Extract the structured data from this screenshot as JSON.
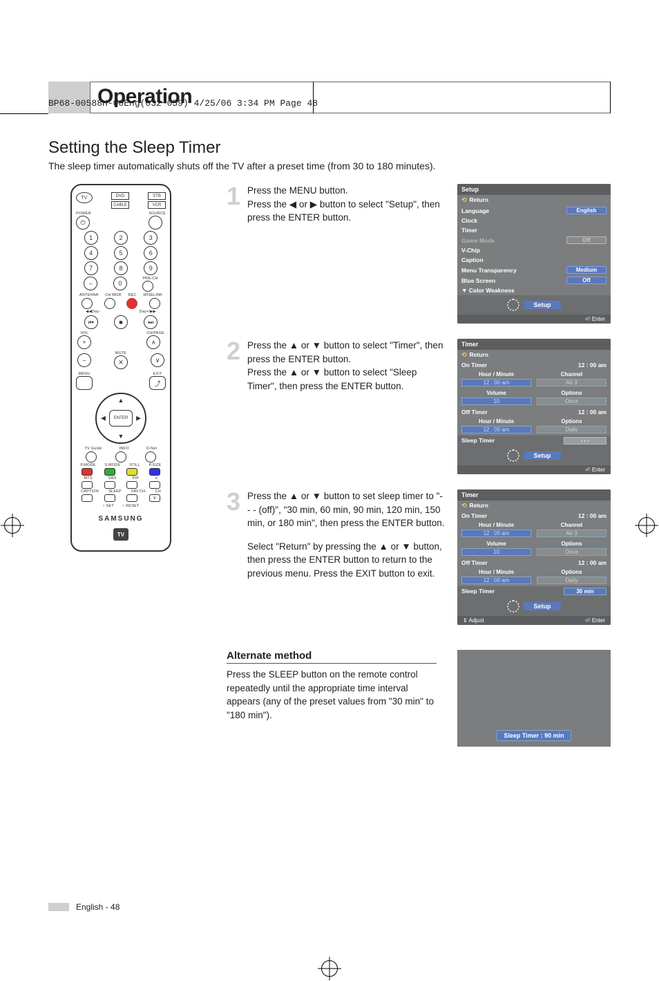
{
  "crop_header": "BP68-00588H-00Eng(032~059)  4/25/06  3:34 PM  Page 48",
  "section_title": "Operation",
  "subtitle": "Setting the Sleep Timer",
  "intro": "The sleep timer automatically shuts off the TV after a preset time (from 30 to 180 minutes).",
  "remote": {
    "tv": "TV",
    "dvd": "DVD",
    "stb": "STB",
    "cable": "CABLE",
    "vcr": "VCR",
    "power": "POWER",
    "source": "SOURCE",
    "prech": "PRE-CH",
    "antenna": "ANTENNA",
    "chmgr": "CH MGR",
    "rec": "REC",
    "wiselink": "WISELINK",
    "day_l": "◀◀Day-",
    "day_r": "Day+/▶▶",
    "vol": "VOL",
    "chpage": "CH/PAGE",
    "mute": "MUTE",
    "menu": "MENU",
    "exit": "EXIT",
    "enter": "ENTER",
    "tvguide": "TV Guide",
    "info": "INFO",
    "dnet": "D-Net",
    "pmode": "P.MODE",
    "smode": "S.MODE",
    "still": "STILL",
    "psize": "P.SIZE",
    "mts": "MTS",
    "srs": "SRS",
    "pip": "PIP",
    "caption": "CAPTION",
    "sleep": "SLEEP",
    "favch": "FAV.CH",
    "ch": "CH",
    "set": "SET",
    "reset": "RESET",
    "brand": "SAMSUNG",
    "tvg": "TV"
  },
  "steps": {
    "s1": {
      "num": "1",
      "text": "Press the MENU button.\nPress the ◀ or ▶ button to select \"Setup\", then press  the ENTER button."
    },
    "s2": {
      "num": "2",
      "text": "Press the ▲ or ▼ button to select \"Timer\", then press the ENTER button.\nPress the ▲ or ▼ button to select \"Sleep Timer\", then press the ENTER button."
    },
    "s3": {
      "num": "3",
      "text_a": "Press the ▲ or ▼ button to set sleep timer to \"- - - (off)\", \"30 min, 60 min, 90 min, 120 min, 150 min, or 180 min\", then press the ENTER button.",
      "text_b": "Select \"Return\" by pressing the ▲ or ▼ button, then press the ENTER button to return to the previous menu. Press the EXIT button to exit."
    }
  },
  "osd1": {
    "title": "Setup",
    "return": "Return",
    "language": "Language",
    "language_v": "English",
    "clock": "Clock",
    "timer": "Timer",
    "game": "Game Mode",
    "game_v": "Off",
    "vchip": "V-Chip",
    "caption": "Caption",
    "mtrans": "Menu Transparency",
    "mtrans_v": "Medium",
    "blue": "Blue Screen",
    "blue_v": "Off",
    "colorw": "▼ Color Weakness",
    "gear": "Setup",
    "enter": "Enter"
  },
  "osd2": {
    "title": "Timer",
    "return": "Return",
    "on_timer": "On Timer",
    "on_timer_v": "12 : 00 am",
    "hm": "Hour / Minute",
    "ch": "Channel",
    "hm_v": "12   :   00     am",
    "ch_v": "Air         3",
    "vol": "Volume",
    "opt": "Options",
    "vol_v": "10",
    "opt_v": "Once",
    "off_timer": "Off Timer",
    "off_timer_v": "12 : 00 am",
    "opt2": "Options",
    "hm2_v": "12   :   00     am",
    "opt2_v": "Daily",
    "sleep": "Sleep Timer",
    "sleep_v": "- - -",
    "gear": "Setup",
    "enter": "Enter"
  },
  "osd3": {
    "title": "Timer",
    "return": "Return",
    "on_timer": "On Timer",
    "on_timer_v": "12 : 00 am",
    "hm": "Hour / Minute",
    "ch": "Channel",
    "hm_v": "12   :   00     am",
    "ch_v": "Air         3",
    "vol": "Volume",
    "opt": "Options",
    "vol_v": "10",
    "opt_v": "Once",
    "off_timer": "Off Timer",
    "off_timer_v": "12 : 00 am",
    "opt2": "Options",
    "hm2_v": "12   :   00     am",
    "opt2_v": "Daily",
    "sleep": "Sleep Timer",
    "sleep_v": "30 min",
    "gear": "Setup",
    "adjust": "Adjust",
    "enter": "Enter"
  },
  "alt": {
    "title": "Alternate method",
    "text": "Press the SLEEP button on the remote control repeatedly until the appropriate time interval appears (any of the preset values from \"30 min\" to \"180 min\").",
    "pill": "Sleep Timer : 90 min"
  },
  "footer": "English - 48"
}
